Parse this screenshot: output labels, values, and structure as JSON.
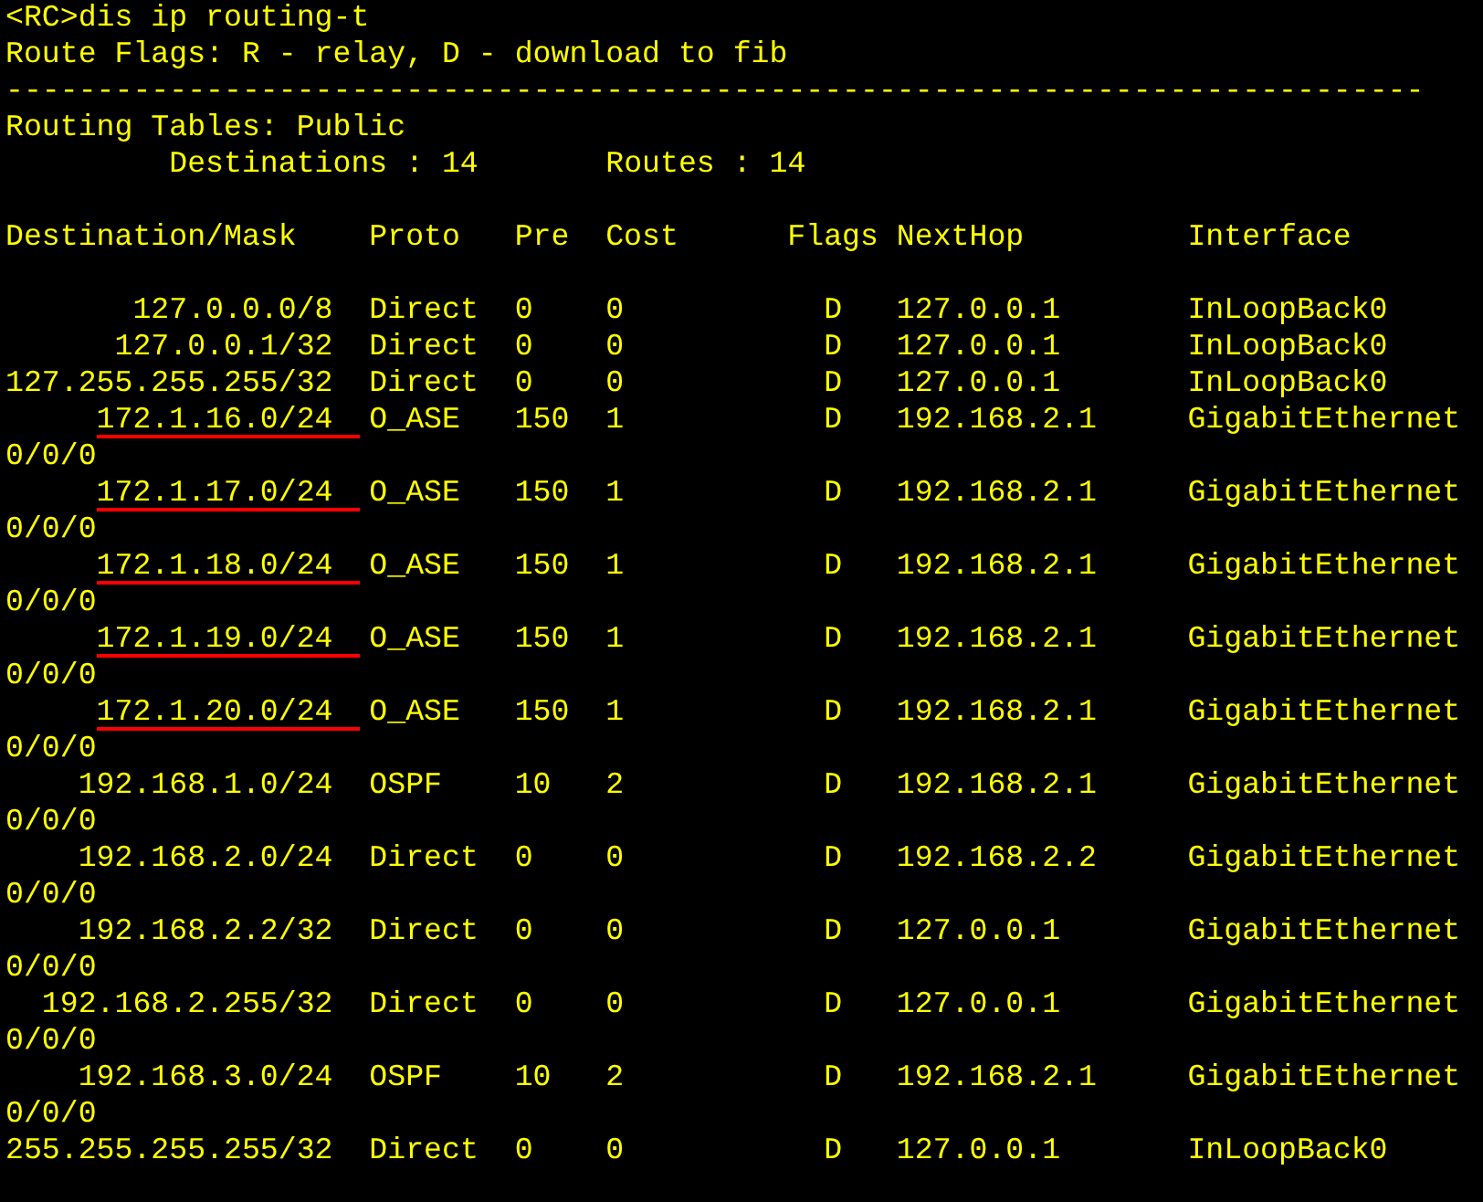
{
  "command": "<RC>dis ip routing-t",
  "legend": "Route Flags: R - relay, D - download to fib",
  "separator": "------------------------------------------------------------------------------",
  "table_title": "Routing Tables: Public",
  "summary": [
    "Destinations : 14",
    "Routes : 14"
  ],
  "columns": [
    "Destination/Mask",
    "Proto",
    "Pre",
    "Cost",
    "Flags",
    "NextHop",
    "Interface"
  ],
  "routes": [
    {
      "destination": "127.0.0.0/8",
      "proto": "Direct",
      "pre": "0",
      "cost": "0",
      "flags": "D",
      "next_hop": "127.0.0.1",
      "interface": "InLoopBack0",
      "underlined": false
    },
    {
      "destination": "127.0.0.1/32",
      "proto": "Direct",
      "pre": "0",
      "cost": "0",
      "flags": "D",
      "next_hop": "127.0.0.1",
      "interface": "InLoopBack0",
      "underlined": false
    },
    {
      "destination": "127.255.255.255/32",
      "proto": "Direct",
      "pre": "0",
      "cost": "0",
      "flags": "D",
      "next_hop": "127.0.0.1",
      "interface": "InLoopBack0",
      "underlined": false
    },
    {
      "destination": "172.1.16.0/24",
      "proto": "O_ASE",
      "pre": "150",
      "cost": "1",
      "flags": "D",
      "next_hop": "192.168.2.1",
      "interface": "GigabitEthernet",
      "wrap": "0/0/0",
      "underlined": true
    },
    {
      "destination": "172.1.17.0/24",
      "proto": "O_ASE",
      "pre": "150",
      "cost": "1",
      "flags": "D",
      "next_hop": "192.168.2.1",
      "interface": "GigabitEthernet",
      "wrap": "0/0/0",
      "underlined": true
    },
    {
      "destination": "172.1.18.0/24",
      "proto": "O_ASE",
      "pre": "150",
      "cost": "1",
      "flags": "D",
      "next_hop": "192.168.2.1",
      "interface": "GigabitEthernet",
      "wrap": "0/0/0",
      "underlined": true
    },
    {
      "destination": "172.1.19.0/24",
      "proto": "O_ASE",
      "pre": "150",
      "cost": "1",
      "flags": "D",
      "next_hop": "192.168.2.1",
      "interface": "GigabitEthernet",
      "wrap": "0/0/0",
      "underlined": true
    },
    {
      "destination": "172.1.20.0/24",
      "proto": "O_ASE",
      "pre": "150",
      "cost": "1",
      "flags": "D",
      "next_hop": "192.168.2.1",
      "interface": "GigabitEthernet",
      "wrap": "0/0/0",
      "underlined": true
    },
    {
      "destination": "192.168.1.0/24",
      "proto": "OSPF",
      "pre": "10",
      "cost": "2",
      "flags": "D",
      "next_hop": "192.168.2.1",
      "interface": "GigabitEthernet",
      "wrap": "0/0/0",
      "underlined": false
    },
    {
      "destination": "192.168.2.0/24",
      "proto": "Direct",
      "pre": "0",
      "cost": "0",
      "flags": "D",
      "next_hop": "192.168.2.2",
      "interface": "GigabitEthernet",
      "wrap": "0/0/0",
      "underlined": false
    },
    {
      "destination": "192.168.2.2/32",
      "proto": "Direct",
      "pre": "0",
      "cost": "0",
      "flags": "D",
      "next_hop": "127.0.0.1",
      "interface": "GigabitEthernet",
      "wrap": "0/0/0",
      "underlined": false
    },
    {
      "destination": "192.168.2.255/32",
      "proto": "Direct",
      "pre": "0",
      "cost": "0",
      "flags": "D",
      "next_hop": "127.0.0.1",
      "interface": "GigabitEthernet",
      "wrap": "0/0/0",
      "underlined": false
    },
    {
      "destination": "192.168.3.0/24",
      "proto": "OSPF",
      "pre": "10",
      "cost": "2",
      "flags": "D",
      "next_hop": "192.168.2.1",
      "interface": "GigabitEthernet",
      "wrap": "0/0/0",
      "underlined": false
    },
    {
      "destination": "255.255.255.255/32",
      "proto": "Direct",
      "pre": "0",
      "cost": "0",
      "flags": "D",
      "next_hop": "127.0.0.1",
      "interface": "InLoopBack0",
      "underlined": false
    }
  ]
}
